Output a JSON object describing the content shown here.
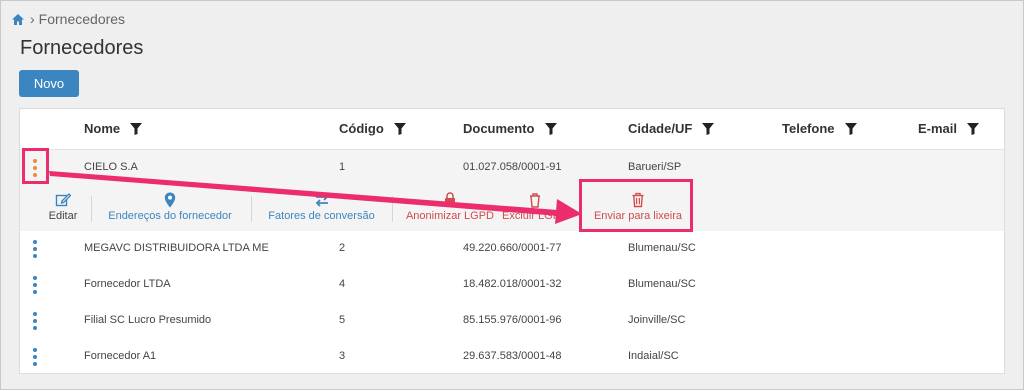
{
  "breadcrumb": {
    "home_icon": "home-icon",
    "separator": "›",
    "current": "Fornecedores"
  },
  "page": {
    "title": "Fornecedores",
    "new_button": "Novo"
  },
  "table": {
    "columns": [
      "Nome",
      "Código",
      "Documento",
      "Cidade/UF",
      "Telefone",
      "E-mail"
    ],
    "rows": [
      {
        "nome": "CIELO S.A",
        "codigo": "1",
        "documento": "01.027.058/0001-91",
        "cidade": "Barueri/SP",
        "telefone": "",
        "email": ""
      },
      {
        "nome": "MEGAVC DISTRIBUIDORA LTDA ME",
        "codigo": "2",
        "documento": "49.220.660/0001-77",
        "cidade": "Blumenau/SC",
        "telefone": "",
        "email": ""
      },
      {
        "nome": "Fornecedor LTDA",
        "codigo": "4",
        "documento": "18.482.018/0001-32",
        "cidade": "Blumenau/SC",
        "telefone": "",
        "email": ""
      },
      {
        "nome": "Filial SC Lucro Presumido",
        "codigo": "5",
        "documento": "85.155.976/0001-96",
        "cidade": "Joinville/SC",
        "telefone": "",
        "email": ""
      },
      {
        "nome": "Fornecedor A1",
        "codigo": "3",
        "documento": "29.637.583/0001-48",
        "cidade": "Indaial/SC",
        "telefone": "",
        "email": ""
      }
    ]
  },
  "row_actions": {
    "edit": "Editar",
    "addresses": "Endereços do fornecedor",
    "conversion": "Fatores de conversão",
    "anonymize": "Anonimizar LGPD",
    "delete_lgpd": "Excluir LGPD",
    "trash": "Enviar para lixeira"
  },
  "colors": {
    "primary": "#3b86c1",
    "danger": "#d14b4b",
    "highlight": "#ec2d6d",
    "kebab_active": "#f0883a"
  }
}
